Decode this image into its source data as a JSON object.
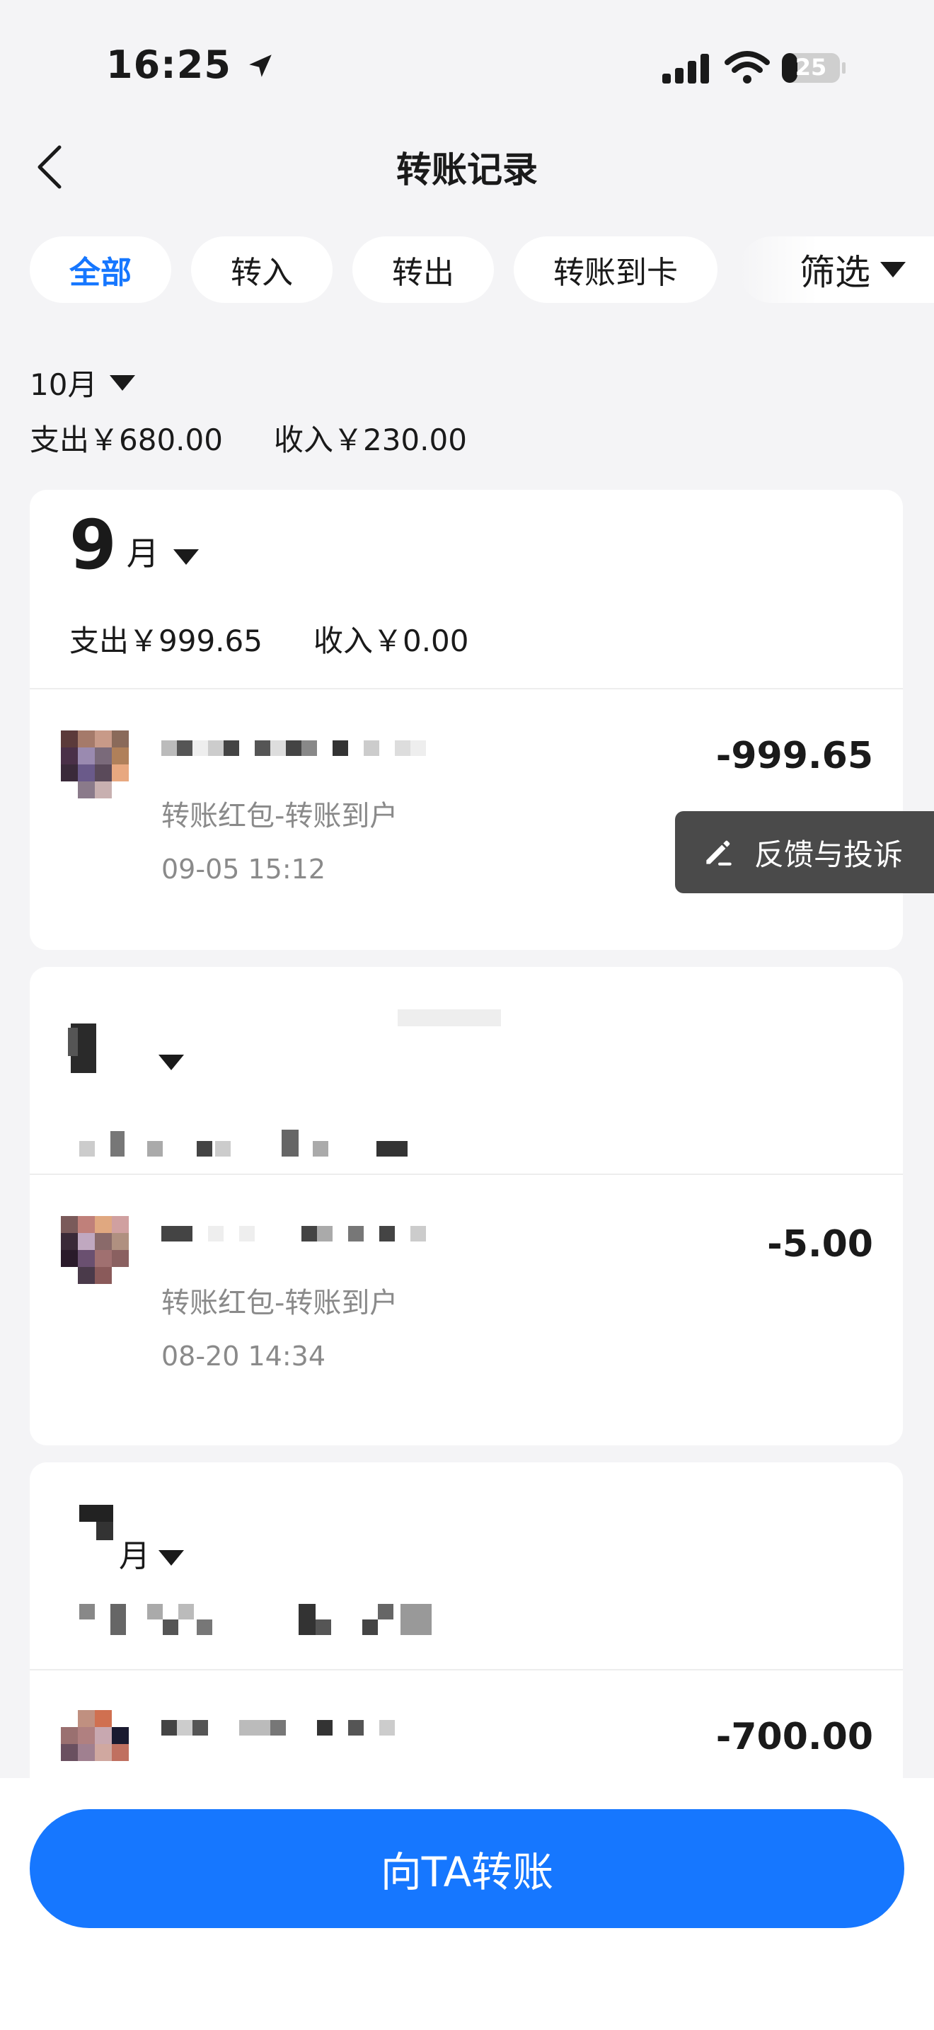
{
  "status_bar": {
    "time": "16:25",
    "battery": "25"
  },
  "nav": {
    "title": "转账记录"
  },
  "filters": {
    "chips": [
      "全部",
      "转入",
      "转出",
      "转账到卡"
    ],
    "filter_label": "筛选"
  },
  "october": {
    "month": "10月",
    "expense": "支出￥680.00",
    "income": "收入￥230.00"
  },
  "september": {
    "month_number": "9",
    "month_unit": "月",
    "expense": "支出￥999.65",
    "income": "收入￥0.00",
    "record": {
      "desc": "转账红包-转账到户",
      "date": "09-05 15:12",
      "amount": "-999.65"
    }
  },
  "august": {
    "record": {
      "desc": "转账红包-转账到户",
      "date": "08-20 14:34",
      "amount": "-5.00"
    }
  },
  "july": {
    "month_unit": "月",
    "record": {
      "amount": "-700.00"
    }
  },
  "feedback": {
    "label": "反馈与投诉"
  },
  "bottom": {
    "transfer_label": "向TA转账"
  }
}
